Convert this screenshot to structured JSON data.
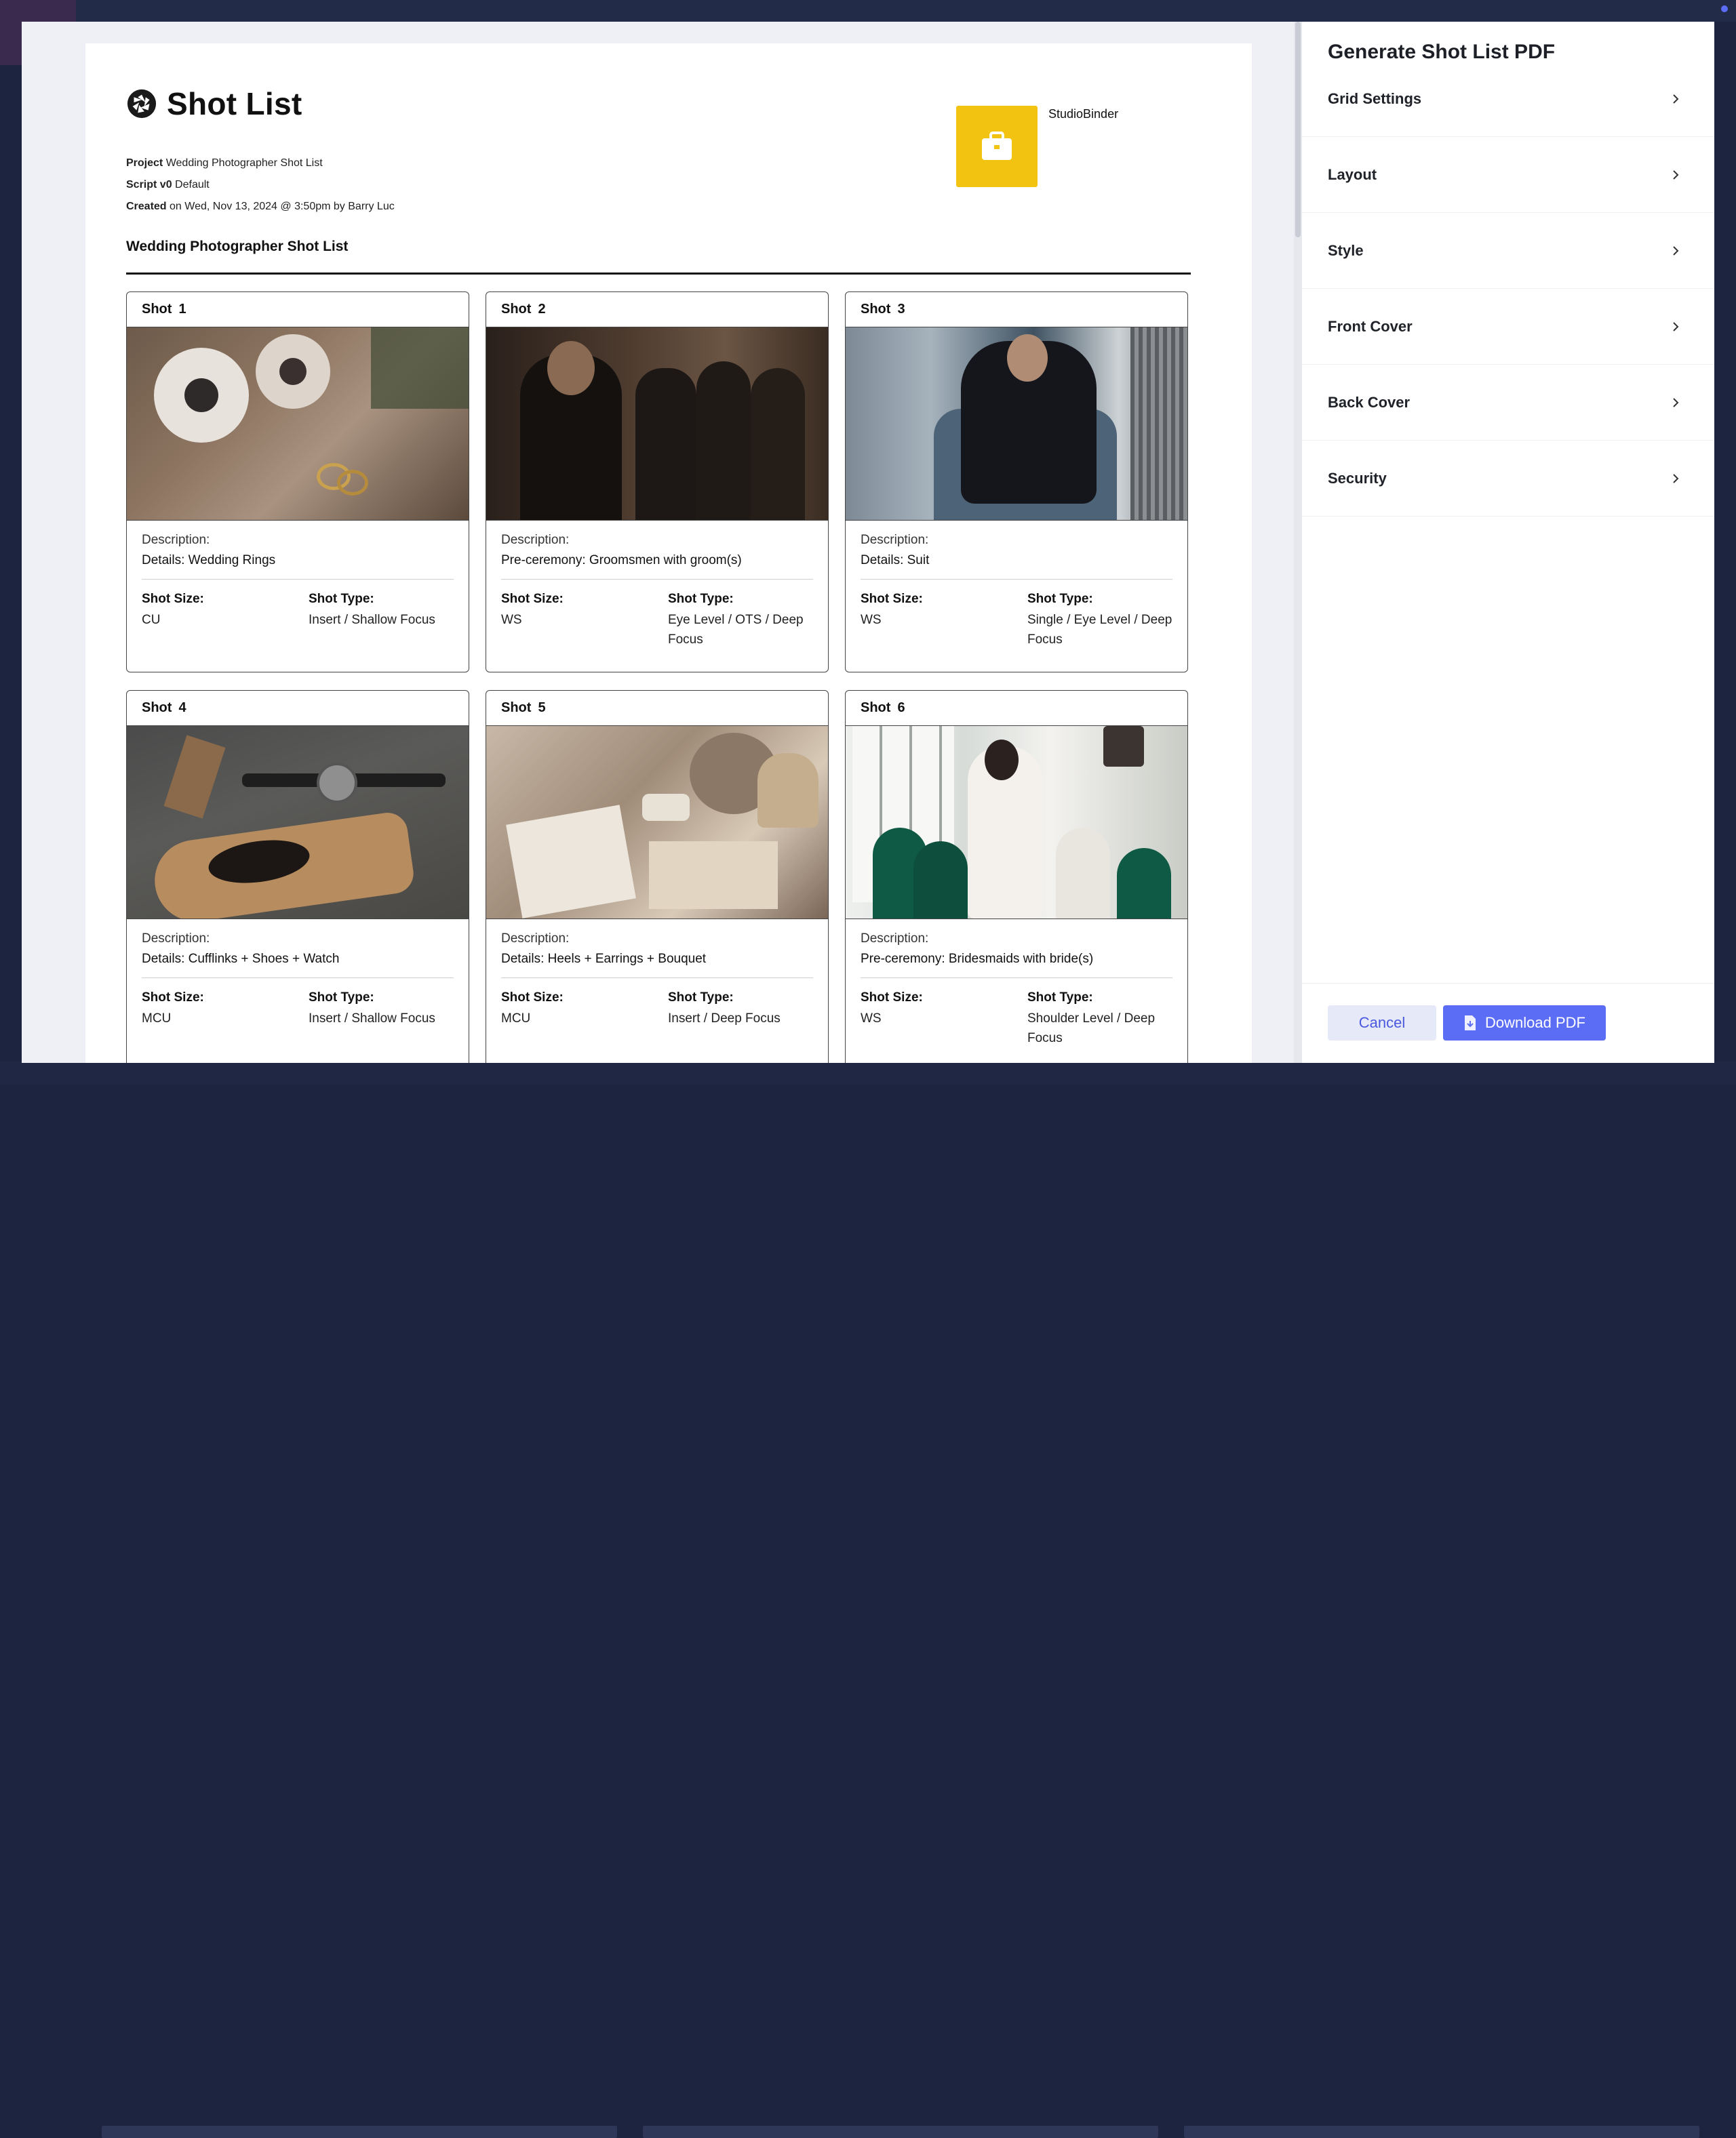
{
  "document": {
    "title": "Shot List",
    "project_label": "Project",
    "project_value": "Wedding Photographer Shot List",
    "script_label": "Script v0",
    "script_value": "Default",
    "created_label": "Created",
    "created_value": "on Wed, Nov 13, 2024 @ 3:50pm by Barry Luc",
    "subtitle": "Wedding Photographer Shot List",
    "company_name": "StudioBinder",
    "logo_color": "#f2c311"
  },
  "shots": [
    {
      "label": "Shot",
      "number": "1",
      "description_label": "Description:",
      "description": "Details: Wedding Rings",
      "size_label": "Shot Size:",
      "size": "CU",
      "type_label": "Shot Type:",
      "type": "Insert / Shallow Focus"
    },
    {
      "label": "Shot",
      "number": "2",
      "description_label": "Description:",
      "description": "Pre-ceremony: Groomsmen with groom(s)",
      "size_label": "Shot Size:",
      "size": "WS",
      "type_label": "Shot Type:",
      "type": "Eye Level / OTS / Deep Focus"
    },
    {
      "label": "Shot",
      "number": "3",
      "description_label": "Description:",
      "description": "Details: Suit",
      "size_label": "Shot Size:",
      "size": "WS",
      "type_label": "Shot Type:",
      "type": "Single / Eye Level / Deep Focus"
    },
    {
      "label": "Shot",
      "number": "4",
      "description_label": "Description:",
      "description": "Details: Cufflinks + Shoes + Watch",
      "size_label": "Shot Size:",
      "size": "MCU",
      "type_label": "Shot Type:",
      "type": "Insert / Shallow Focus"
    },
    {
      "label": "Shot",
      "number": "5",
      "description_label": "Description:",
      "description": "Details: Heels + Earrings + Bouquet",
      "size_label": "Shot Size:",
      "size": "MCU",
      "type_label": "Shot Type:",
      "type": "Insert / Deep Focus"
    },
    {
      "label": "Shot",
      "number": "6",
      "description_label": "Description:",
      "description": "Pre-ceremony: Bridesmaids with bride(s)",
      "size_label": "Shot Size:",
      "size": "WS",
      "type_label": "Shot Type:",
      "type": "Shoulder Level / Deep Focus"
    }
  ],
  "panel": {
    "title": "Generate Shot List PDF",
    "sections": [
      {
        "label": "Grid Settings"
      },
      {
        "label": "Layout"
      },
      {
        "label": "Style"
      },
      {
        "label": "Front Cover"
      },
      {
        "label": "Back Cover"
      },
      {
        "label": "Security"
      }
    ],
    "cancel_label": "Cancel",
    "download_label": "Download PDF",
    "accent_color": "#5b6cf5"
  }
}
